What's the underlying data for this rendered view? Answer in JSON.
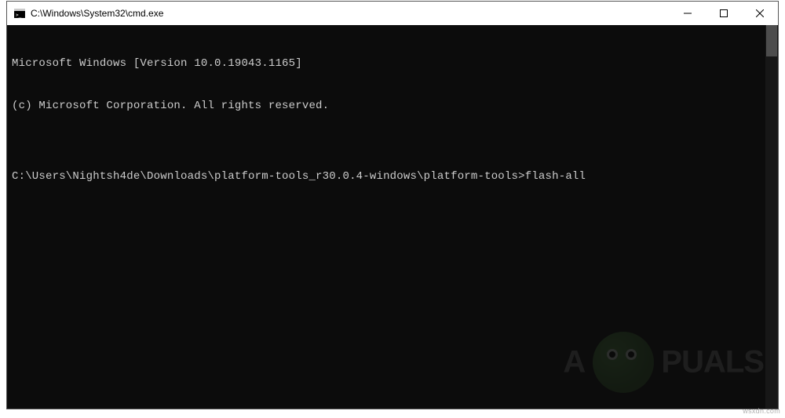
{
  "window": {
    "title": "C:\\Windows\\System32\\cmd.exe"
  },
  "terminal": {
    "line1": "Microsoft Windows [Version 10.0.19043.1165]",
    "line2": "(c) Microsoft Corporation. All rights reserved.",
    "blank": "",
    "prompt": "C:\\Users\\Nightsh4de\\Downloads\\platform-tools_r30.0.4-windows\\platform-tools>",
    "command": "flash-all"
  },
  "watermark": {
    "text_left": "A",
    "text_right": "PUALS"
  },
  "attrib": "wsxdn.com"
}
